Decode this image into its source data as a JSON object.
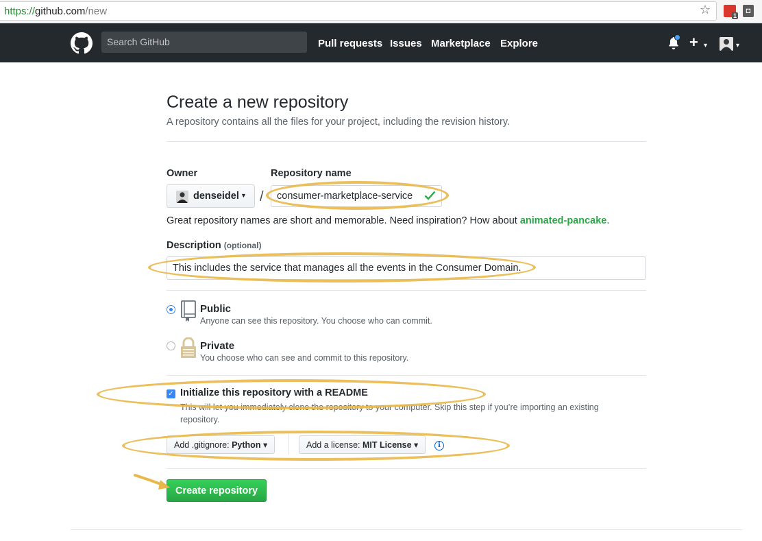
{
  "browser": {
    "url_scheme": "https://",
    "url_host": "github.com",
    "url_path": "/new",
    "extension_badge": "1"
  },
  "header": {
    "search_placeholder": "Search GitHub",
    "nav": [
      "Pull requests",
      "Issues",
      "Marketplace",
      "Explore"
    ]
  },
  "page": {
    "title": "Create a new repository",
    "subtitle": "A repository contains all the files for your project, including the revision history."
  },
  "form": {
    "owner_label": "Owner",
    "owner_value": "denseidel",
    "repo_label": "Repository name",
    "repo_value": "consumer-marketplace-service",
    "separator": "/",
    "hint_text": "Great repository names are short and memorable. Need inspiration? How about ",
    "hint_suggestion": "animated-pancake",
    "hint_end": ".",
    "description_label": "Description",
    "description_optional": "(optional)",
    "description_value": "This includes the service that manages all the events in the Consumer Domain.",
    "visibility": {
      "public_title": "Public",
      "public_note": "Anyone can see this repository. You choose who can commit.",
      "private_title": "Private",
      "private_note": "You choose who can see and commit to this repository.",
      "selected": "Public"
    },
    "readme_label": "Initialize this repository with a README",
    "readme_checked": true,
    "readme_note": "This will let you immediately clone the repository to your computer. Skip this step if you’re importing an existing repository.",
    "gitignore_prefix": "Add .gitignore:",
    "gitignore_value": "Python",
    "license_prefix": "Add a license:",
    "license_value": "MIT License",
    "submit_label": "Create repository"
  },
  "colors": {
    "header_bg": "#24292e",
    "primary_green": "#28a745",
    "highlight": "#e8b84a",
    "accent_blue": "#3b86f5"
  }
}
